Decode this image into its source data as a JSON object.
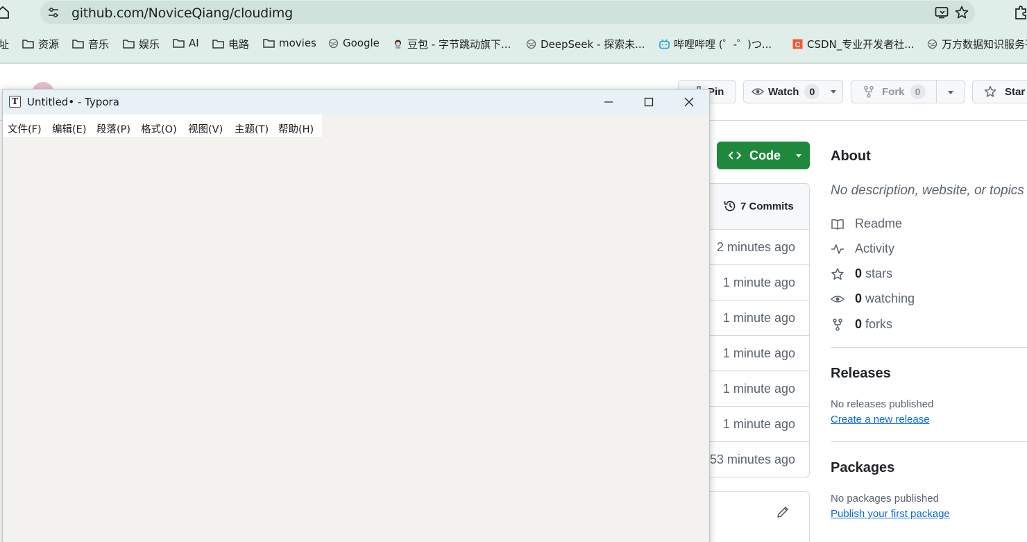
{
  "browser": {
    "url": "github.com/NoviceQiang/cloudimg",
    "bookmarks": [
      {
        "label": "址",
        "icon": "none"
      },
      {
        "label": "资源",
        "icon": "folder-icon"
      },
      {
        "label": "音乐",
        "icon": "folder-icon"
      },
      {
        "label": "娱乐",
        "icon": "folder-icon"
      },
      {
        "label": "AI",
        "icon": "folder-icon"
      },
      {
        "label": "电路",
        "icon": "folder-icon"
      },
      {
        "label": "movies",
        "icon": "folder-icon"
      },
      {
        "label": "Google",
        "icon": "globe-icon"
      },
      {
        "label": "豆包 - 字节跳动旗下...",
        "icon": "doubao-icon"
      },
      {
        "label": "DeepSeek - 探索未...",
        "icon": "globe-icon"
      },
      {
        "label": "哔哩哔哩 (゜-゜)つ...",
        "icon": "bilibili-icon"
      },
      {
        "label": "CSDN_专业开发者社...",
        "icon": "csdn-icon"
      },
      {
        "label": "万方数据知识服务平",
        "icon": "globe-icon"
      }
    ]
  },
  "github": {
    "buttons": {
      "pin": "Pin",
      "watch": "Watch",
      "watch_count": "0",
      "fork": "Fork",
      "fork_count": "0",
      "star": "Star"
    },
    "code_button": "Code",
    "commits_label": "7 Commits",
    "commit_times": [
      "2 minutes ago",
      "1 minute ago",
      "1 minute ago",
      "1 minute ago",
      "1 minute ago",
      "1 minute ago",
      "53 minutes ago"
    ],
    "about": {
      "title": "About",
      "description": "No description, website, or topics",
      "readme": "Readme",
      "activity": "Activity",
      "stars_count": "0",
      "stars_label": "stars",
      "watching_count": "0",
      "watching_label": "watching",
      "forks_count": "0",
      "forks_label": "forks"
    },
    "releases": {
      "title": "Releases",
      "text": "No releases published",
      "link": "Create a new release"
    },
    "packages": {
      "title": "Packages",
      "text": "No packages published",
      "link": "Publish your first package"
    }
  },
  "typora": {
    "title": "Untitled• - Typora",
    "app_icon_letter": "T",
    "menu": [
      "文件(F)",
      "编辑(E)",
      "段落(P)",
      "格式(O)",
      "视图(V)",
      "主题(T)",
      "帮助(H)"
    ]
  },
  "colors": {
    "chrome_bg": "#dfeee9",
    "omnibox_bg": "#cfe3dc",
    "code_green": "#1f883d",
    "link_blue": "#0969da",
    "typora_editor_bg": "#f3f2ee"
  }
}
